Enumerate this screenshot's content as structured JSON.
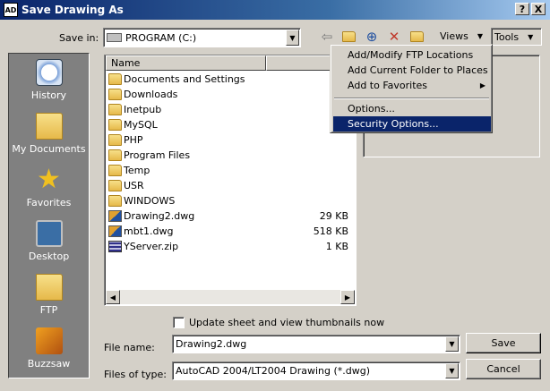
{
  "window": {
    "title": "Save Drawing As",
    "app_icon_text": "AD",
    "help_btn": "?",
    "close_btn": "X"
  },
  "save_in": {
    "label": "Save in:",
    "value": "PROGRAM (C:)"
  },
  "toolbar": {
    "views_label": "Views",
    "tools_label": "Tools"
  },
  "places": [
    {
      "label": "History",
      "icon": "history-icon"
    },
    {
      "label": "My Documents",
      "icon": "my-documents-icon"
    },
    {
      "label": "Favorites",
      "icon": "favorites-icon"
    },
    {
      "label": "Desktop",
      "icon": "desktop-icon"
    },
    {
      "label": "FTP",
      "icon": "ftp-icon"
    },
    {
      "label": "Buzzsaw",
      "icon": "buzzsaw-icon"
    }
  ],
  "file_list": {
    "col_name": "Name",
    "col_size": "",
    "files": [
      {
        "name": "Documents and Settings",
        "type": "folder",
        "size": ""
      },
      {
        "name": "Downloads",
        "type": "folder",
        "size": ""
      },
      {
        "name": "Inetpub",
        "type": "folder",
        "size": ""
      },
      {
        "name": "MySQL",
        "type": "folder",
        "size": ""
      },
      {
        "name": "PHP",
        "type": "folder",
        "size": ""
      },
      {
        "name": "Program Files",
        "type": "folder",
        "size": ""
      },
      {
        "name": "Temp",
        "type": "folder",
        "size": ""
      },
      {
        "name": "USR",
        "type": "folder",
        "size": ""
      },
      {
        "name": "WINDOWS",
        "type": "folder",
        "size": ""
      },
      {
        "name": "Drawing2.dwg",
        "type": "dwg",
        "size": "29 KB"
      },
      {
        "name": "mbt1.dwg",
        "type": "dwg",
        "size": "518 KB"
      },
      {
        "name": "YServer.zip",
        "type": "zip",
        "size": "1 KB"
      }
    ]
  },
  "tools_menu": {
    "items": [
      "Add/Modify FTP Locations",
      "Add Current Folder to Places",
      "Add to Favorites",
      "Options...",
      "Security Options..."
    ],
    "selected": "Security Options..."
  },
  "thumbnail_checkbox": {
    "label": "Update sheet and view thumbnails now",
    "checked": false
  },
  "file_name": {
    "label": "File name:",
    "value": "Drawing2.dwg"
  },
  "file_type": {
    "label": "Files of type:",
    "value": "AutoCAD 2004/LT2004 Drawing (*.dwg)"
  },
  "buttons": {
    "save": "Save",
    "cancel": "Cancel"
  },
  "colors": {
    "title_start": "#0a246a",
    "title_end": "#a6caf0",
    "menu_highlight": "#0a246a",
    "face": "#d4d0c8"
  }
}
